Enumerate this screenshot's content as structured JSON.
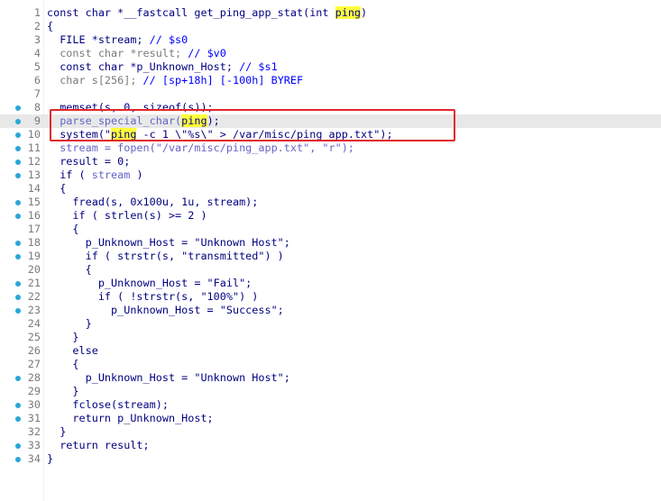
{
  "lines": [
    {
      "n": "1",
      "dot": false,
      "cur": false,
      "segs": [
        [
          "const char *__fastcall get_ping_app_stat(int ",
          "fn"
        ],
        [
          "ping",
          "hl"
        ],
        [
          ")",
          "fn"
        ]
      ]
    },
    {
      "n": "2",
      "dot": false,
      "cur": false,
      "segs": [
        [
          "{",
          "fn"
        ]
      ]
    },
    {
      "n": "3",
      "dot": false,
      "cur": false,
      "segs": [
        [
          "  FILE *stream; ",
          "fn"
        ],
        [
          "// $s0",
          "blue"
        ]
      ]
    },
    {
      "n": "4",
      "dot": false,
      "cur": false,
      "segs": [
        [
          "  const char *result; ",
          "gray"
        ],
        [
          "// $v0",
          "blue"
        ]
      ]
    },
    {
      "n": "5",
      "dot": false,
      "cur": false,
      "segs": [
        [
          "  const char *p_Unknown_Host; ",
          "fn"
        ],
        [
          "// $s1",
          "blue"
        ]
      ]
    },
    {
      "n": "6",
      "dot": false,
      "cur": false,
      "segs": [
        [
          "  char s[256]; ",
          "gray"
        ],
        [
          "// [sp+18h] [-100h] BYREF",
          "blue"
        ]
      ]
    },
    {
      "n": "7",
      "dot": false,
      "cur": false,
      "segs": [
        [
          "",
          "fn"
        ]
      ]
    },
    {
      "n": "8",
      "dot": true,
      "cur": false,
      "segs": [
        [
          "  memset(s, 0, sizeof(s));",
          "fn"
        ]
      ]
    },
    {
      "n": "9",
      "dot": true,
      "cur": true,
      "segs": [
        [
          "  parse_special_char(",
          "gv"
        ],
        [
          "ping",
          "hl"
        ],
        [
          ");",
          "fn"
        ]
      ]
    },
    {
      "n": "10",
      "dot": true,
      "cur": false,
      "segs": [
        [
          "  system(\"",
          "fn"
        ],
        [
          "ping",
          "hl"
        ],
        [
          " -c 1 \\\"%s\\\" > /var/misc/ping_app.txt\");",
          "fn"
        ]
      ]
    },
    {
      "n": "11",
      "dot": true,
      "cur": false,
      "segs": [
        [
          "  stream = fopen(\"/var/misc/ping_app.txt\", \"r\");",
          "gv"
        ]
      ]
    },
    {
      "n": "12",
      "dot": true,
      "cur": false,
      "segs": [
        [
          "  result = 0;",
          "fn"
        ]
      ]
    },
    {
      "n": "13",
      "dot": true,
      "cur": false,
      "segs": [
        [
          "  if ( ",
          "fn"
        ],
        [
          "stream",
          "gv"
        ],
        [
          " )",
          "fn"
        ]
      ]
    },
    {
      "n": "14",
      "dot": false,
      "cur": false,
      "segs": [
        [
          "  {",
          "fn"
        ]
      ]
    },
    {
      "n": "15",
      "dot": true,
      "cur": false,
      "segs": [
        [
          "    fread(s, 0x100u, 1u, stream);",
          "fn"
        ]
      ]
    },
    {
      "n": "16",
      "dot": true,
      "cur": false,
      "segs": [
        [
          "    if ( strlen(s) >= 2 )",
          "fn"
        ]
      ]
    },
    {
      "n": "17",
      "dot": false,
      "cur": false,
      "segs": [
        [
          "    {",
          "fn"
        ]
      ]
    },
    {
      "n": "18",
      "dot": true,
      "cur": false,
      "segs": [
        [
          "      p_Unknown_Host = \"Unknown Host\";",
          "fn"
        ]
      ]
    },
    {
      "n": "19",
      "dot": true,
      "cur": false,
      "segs": [
        [
          "      if ( strstr(s, \"transmitted\") )",
          "fn"
        ]
      ]
    },
    {
      "n": "20",
      "dot": false,
      "cur": false,
      "segs": [
        [
          "      {",
          "fn"
        ]
      ]
    },
    {
      "n": "21",
      "dot": true,
      "cur": false,
      "segs": [
        [
          "        p_Unknown_Host = \"Fail\";",
          "fn"
        ]
      ]
    },
    {
      "n": "22",
      "dot": true,
      "cur": false,
      "segs": [
        [
          "        if ( !strstr(s, \"100%\") )",
          "fn"
        ]
      ]
    },
    {
      "n": "23",
      "dot": true,
      "cur": false,
      "segs": [
        [
          "          p_Unknown_Host = \"Success\";",
          "fn"
        ]
      ]
    },
    {
      "n": "24",
      "dot": false,
      "cur": false,
      "segs": [
        [
          "      }",
          "fn"
        ]
      ]
    },
    {
      "n": "25",
      "dot": false,
      "cur": false,
      "segs": [
        [
          "    }",
          "fn"
        ]
      ]
    },
    {
      "n": "26",
      "dot": false,
      "cur": false,
      "segs": [
        [
          "    else",
          "fn"
        ]
      ]
    },
    {
      "n": "27",
      "dot": false,
      "cur": false,
      "segs": [
        [
          "    {",
          "fn"
        ]
      ]
    },
    {
      "n": "28",
      "dot": true,
      "cur": false,
      "segs": [
        [
          "      p_Unknown_Host = \"Unknown Host\";",
          "fn"
        ]
      ]
    },
    {
      "n": "29",
      "dot": false,
      "cur": false,
      "segs": [
        [
          "    }",
          "fn"
        ]
      ]
    },
    {
      "n": "30",
      "dot": true,
      "cur": false,
      "segs": [
        [
          "    fclose(stream);",
          "fn"
        ]
      ]
    },
    {
      "n": "31",
      "dot": true,
      "cur": false,
      "segs": [
        [
          "    return p_Unknown_Host;",
          "fn"
        ]
      ]
    },
    {
      "n": "32",
      "dot": false,
      "cur": false,
      "segs": [
        [
          "  }",
          "fn"
        ]
      ]
    },
    {
      "n": "33",
      "dot": true,
      "cur": false,
      "segs": [
        [
          "  return result;",
          "fn"
        ]
      ]
    },
    {
      "n": "34",
      "dot": true,
      "cur": false,
      "segs": [
        [
          "}",
          "fn"
        ]
      ]
    }
  ],
  "colors": {
    "highlight": "#ffff3b",
    "annotation_box": "#e0262b",
    "breakpoint_dot": "#2aa6d8"
  }
}
